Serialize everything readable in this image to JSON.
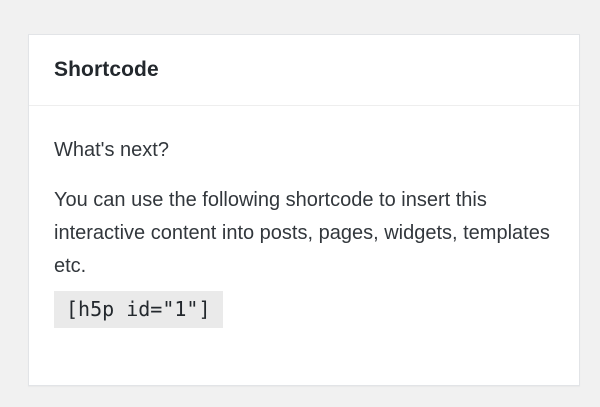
{
  "panel": {
    "title": "Shortcode",
    "lead": "What's next?",
    "description": "You can use the following shortcode to insert this interactive content into posts, pages, widgets, templates etc.",
    "shortcode": "[h5p id=\"1\"]"
  }
}
